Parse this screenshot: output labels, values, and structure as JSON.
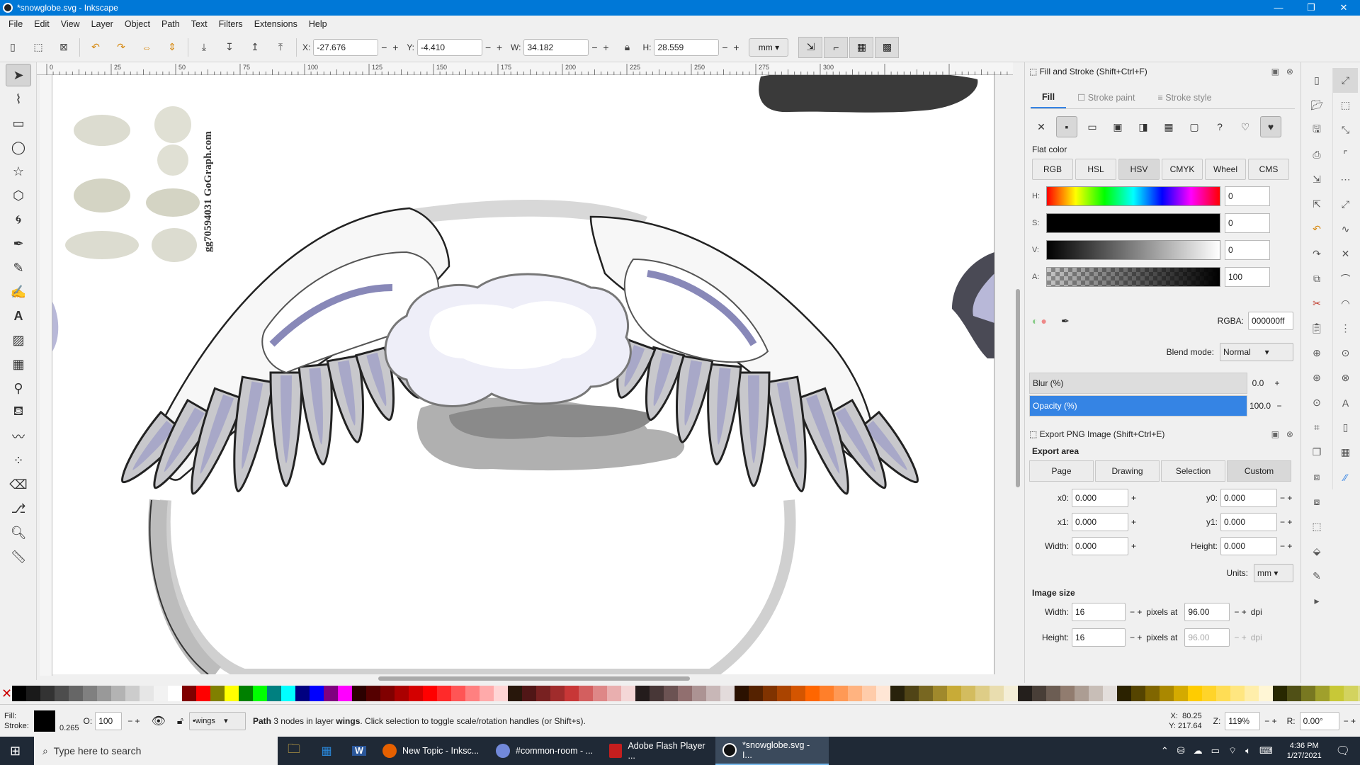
{
  "window": {
    "title": "*snowglobe.svg - Inkscape"
  },
  "menu": [
    "File",
    "Edit",
    "View",
    "Layer",
    "Object",
    "Path",
    "Text",
    "Filters",
    "Extensions",
    "Help"
  ],
  "toolbar": {
    "x_label": "X:",
    "x_value": "-27.676",
    "y_label": "Y:",
    "y_value": "-4.410",
    "w_label": "W:",
    "w_value": "34.182",
    "h_label": "H:",
    "h_value": "28.559",
    "unit": "mm"
  },
  "rulers": {
    "h_ticks": [
      "0",
      "25",
      "50",
      "75",
      "100",
      "125",
      "150",
      "175",
      "200",
      "225",
      "250",
      "275",
      "300"
    ]
  },
  "canvas": {
    "watermark": "gg70594031 GoGraph.com"
  },
  "fill_stroke": {
    "title": "Fill and Stroke (Shift+Ctrl+F)",
    "tabs": [
      "Fill",
      "Stroke paint",
      "Stroke style"
    ],
    "flat_color_label": "Flat color",
    "color_modes": [
      "RGB",
      "HSL",
      "HSV",
      "CMYK",
      "Wheel",
      "CMS"
    ],
    "active_mode": "HSV",
    "sliders": [
      {
        "label": "H:",
        "value": "0"
      },
      {
        "label": "S:",
        "value": "0"
      },
      {
        "label": "V:",
        "value": "0"
      },
      {
        "label": "A:",
        "value": "100"
      }
    ],
    "rgba_label": "RGBA:",
    "rgba_value": "000000ff",
    "blend_label": "Blend mode:",
    "blend_value": "Normal",
    "blur_label": "Blur (%)",
    "blur_value": "0.0",
    "opacity_label": "Opacity (%)",
    "opacity_value": "100.0"
  },
  "export": {
    "title": "Export PNG Image (Shift+Ctrl+E)",
    "area_label": "Export area",
    "area_buttons": [
      "Page",
      "Drawing",
      "Selection",
      "Custom"
    ],
    "active_area": "Custom",
    "x0_label": "x0:",
    "x0": "0.000",
    "y0_label": "y0:",
    "y0": "0.000",
    "x1_label": "x1:",
    "x1": "0.000",
    "y1_label": "y1:",
    "y1": "0.000",
    "width_label": "Width:",
    "width": "0.000",
    "height_label": "Height:",
    "height": "0.000",
    "units_label": "Units:",
    "units": "mm",
    "image_size_label": "Image size",
    "img_width_label": "Width:",
    "img_width": "16",
    "img_height_label": "Height:",
    "img_height": "16",
    "pixels_at": "pixels at",
    "dpi1": "96.00",
    "dpi2": "96.00",
    "dpi_unit": "dpi"
  },
  "status": {
    "fill_label": "Fill:",
    "stroke_label": "Stroke:",
    "stroke_width": "0.265",
    "o_label": "O:",
    "o_value": "100",
    "layer": "•wings",
    "message_pre": "Path",
    "message_mid": " 3 nodes in layer ",
    "message_layer": "wings",
    "message_post": ". Click selection to toggle scale/rotation handles (or Shift+s).",
    "x_coord_label": "X:",
    "x_coord": "80.25",
    "y_coord_label": "Y:",
    "y_coord": "217.64",
    "z_label": "Z:",
    "zoom": "119%",
    "r_label": "R:",
    "rotation": "0.00°"
  },
  "taskbar": {
    "search_placeholder": "Type here to search",
    "apps": [
      "New Topic - Inksc...",
      "#common-room - ...",
      "Adobe Flash Player ...",
      "*snowglobe.svg - I..."
    ],
    "time": "4:36 PM",
    "date": "1/27/2021"
  },
  "colors": {
    "accent": "#0078d7",
    "selection": "#3584e4",
    "wing_shadow": "#a8a8c8",
    "feather_gray": "#c8c8cc"
  }
}
